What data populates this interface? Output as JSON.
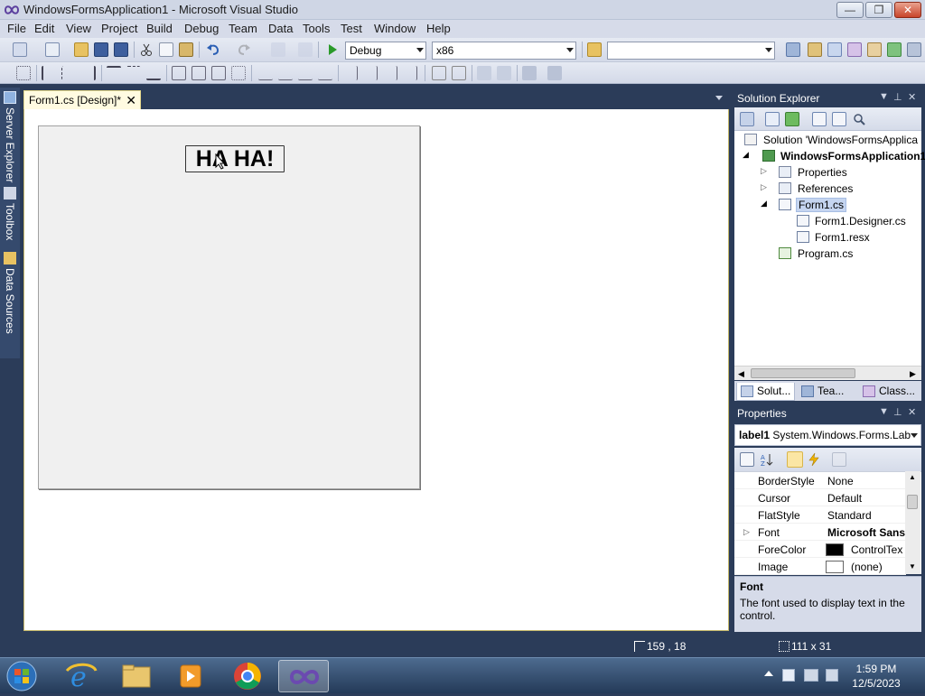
{
  "window": {
    "title": "WindowsFormsApplication1 - Microsoft Visual Studio",
    "controls": {
      "minimize": "—",
      "maximize": "❐",
      "close": "✕"
    }
  },
  "menu": [
    "File",
    "Edit",
    "View",
    "Project",
    "Build",
    "Debug",
    "Team",
    "Data",
    "Tools",
    "Test",
    "Window",
    "Help"
  ],
  "toolbar": {
    "config": "Debug",
    "platform": "x86",
    "find": ""
  },
  "side_tabs": [
    "Server Explorer",
    "Toolbox",
    "Data Sources"
  ],
  "document": {
    "tab_label": "Form1.cs [Design]*",
    "label_text": "HA HA!"
  },
  "solution_explorer": {
    "title": "Solution Explorer",
    "items": [
      {
        "label": "Solution 'WindowsFormsApplica",
        "bold": false
      },
      {
        "label": "WindowsFormsApplication1",
        "bold": true
      },
      {
        "label": "Properties",
        "bold": false
      },
      {
        "label": "References",
        "bold": false
      },
      {
        "label": "Form1.cs",
        "bold": false
      },
      {
        "label": "Form1.Designer.cs",
        "bold": false
      },
      {
        "label": "Form1.resx",
        "bold": false
      },
      {
        "label": "Program.cs",
        "bold": false
      }
    ],
    "tabs": [
      "Solut...",
      "Tea...",
      "Class..."
    ]
  },
  "properties": {
    "title": "Properties",
    "selected_object": "label1",
    "selected_type": "System.Windows.Forms.Lab",
    "rows": [
      {
        "name": "BorderStyle",
        "value": "None"
      },
      {
        "name": "Cursor",
        "value": "Default"
      },
      {
        "name": "FlatStyle",
        "value": "Standard"
      },
      {
        "name": "Font",
        "value": "Microsoft Sans"
      },
      {
        "name": "ForeColor",
        "value": "ControlTex"
      },
      {
        "name": "Image",
        "value": "(none)"
      }
    ],
    "desc_title": "Font",
    "desc_text": "The font used to display text in the control."
  },
  "status": {
    "position": "159 , 18",
    "size": "111 x 31"
  },
  "taskbar": {
    "time": "1:59 PM",
    "date": "12/5/2023"
  },
  "colors": {
    "frame": "#2b3c59",
    "doc_border": "#e5d88c",
    "selection": "#c5d5f0"
  }
}
